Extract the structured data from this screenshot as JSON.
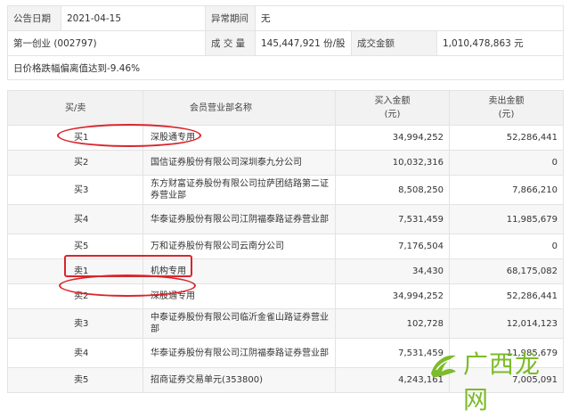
{
  "info": {
    "announce_label": "公告日期",
    "announce_date": "2021-04-15",
    "abnormal_label": "异常期间",
    "abnormal_value": "无",
    "stock_name": "第一创业 (002797)",
    "volume_label": "成 交 量",
    "volume_value": "145,447,921 份/股",
    "amount_label": "成交金额",
    "amount_value": "1,010,478,863 元",
    "reason": "日价格跌幅偏离值达到-9.46%"
  },
  "table": {
    "headers": {
      "side": "买/卖",
      "member": "会员营业部名称",
      "buy": "买入金额",
      "buy_unit": "(元)",
      "sell": "卖出金额",
      "sell_unit": "(元)"
    },
    "rows": [
      {
        "side": "买1",
        "member": "深股通专用",
        "buy": "34,994,252",
        "sell": "52,286,441"
      },
      {
        "side": "买2",
        "member": "国信证券股份有限公司深圳泰九分公司",
        "buy": "10,032,316",
        "sell": "0"
      },
      {
        "side": "买3",
        "member": "东方财富证券股份有限公司拉萨团结路第二证券营业部",
        "buy": "8,508,250",
        "sell": "7,866,210"
      },
      {
        "side": "买4",
        "member": "华泰证券股份有限公司江阴福泰路证券营业部",
        "buy": "7,531,459",
        "sell": "11,985,679"
      },
      {
        "side": "买5",
        "member": "万和证券股份有限公司云南分公司",
        "buy": "7,176,504",
        "sell": "0"
      },
      {
        "side": "卖1",
        "member": "机构专用",
        "buy": "34,430",
        "sell": "68,175,082"
      },
      {
        "side": "卖2",
        "member": "深股通专用",
        "buy": "34,994,252",
        "sell": "52,286,441"
      },
      {
        "side": "卖3",
        "member": "中泰证券股份有限公司临沂金雀山路证券营业部",
        "buy": "102,728",
        "sell": "12,014,123"
      },
      {
        "side": "卖4",
        "member": "华泰证券股份有限公司江阴福泰路证券营业部",
        "buy": "7,531,459",
        "sell": "11,985,679"
      },
      {
        "side": "卖5",
        "member": "招商证券交易单元(353800)",
        "buy": "4,243,161",
        "sell": "7,005,091"
      }
    ]
  },
  "watermark": {
    "text": "广西龙网",
    "color": "#7cbb2a"
  },
  "marks_color": "#d9252b"
}
